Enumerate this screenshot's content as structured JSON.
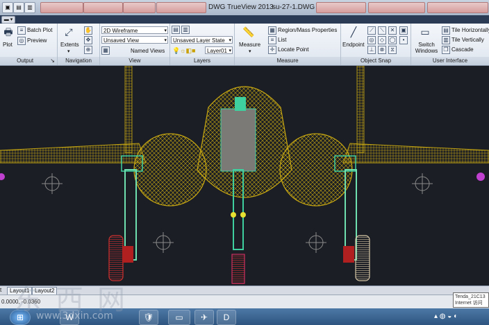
{
  "window": {
    "title": "DWG TrueView 2013",
    "file": "su-27-1.DWG"
  },
  "ribbon": {
    "output": {
      "label": "Output",
      "plot": "Plot",
      "batch_plot": "Batch Plot",
      "preview": "Preview"
    },
    "navigation": {
      "label": "Navigation",
      "extents": "Extents"
    },
    "view": {
      "label": "View",
      "visual_style": "2D Wireframe",
      "saved_view": "Unsaved View",
      "named_views": "Named Views"
    },
    "layers": {
      "label": "Layers",
      "layer_state": "Unsaved Layer State",
      "current_layer": "Layer01"
    },
    "measure": {
      "label": "Measure",
      "measure": "Measure",
      "region_mass": "Region/Mass Properties",
      "list": "List",
      "locate_point": "Locate Point"
    },
    "object_snap": {
      "label": "Object Snap",
      "endpoint": "Endpoint"
    },
    "ui": {
      "label": "User Interface",
      "switch_windows": "Switch Windows",
      "tile_h": "Tile Horizontally",
      "tile_v": "Tile Vertically",
      "cascade": "Cascade"
    }
  },
  "layout_tabs": [
    "Layout1",
    "Layout2"
  ],
  "status": {
    "coords": "0.0000, -0.0360"
  },
  "tooltip": {
    "line1": "Tenda_21C13",
    "line2": "Internet 访问"
  },
  "watermark": {
    "logo_text": "东西网",
    "site": "www.3dxin.com"
  },
  "colors": {
    "wire_yellow": "#c8a812",
    "gear_green": "#3fd0a0",
    "wheel_red": "#d03030",
    "magenta": "#c040d0"
  }
}
